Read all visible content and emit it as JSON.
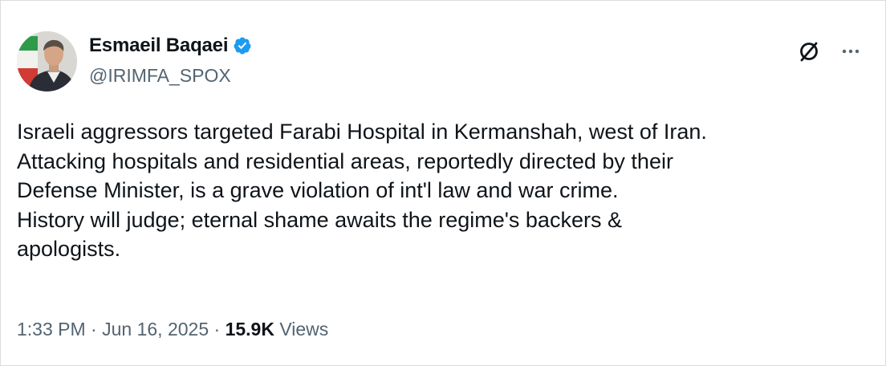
{
  "author": {
    "display_name": "Esmaeil Baqaei",
    "handle": "@IRIMFA_SPOX",
    "verified": true,
    "verified_color": "#1d9bf0"
  },
  "tweet": {
    "lines": [
      "Israeli aggressors targeted Farabi Hospital in Kermanshah, west of Iran.",
      "Attacking hospitals and residential areas, reportedly directed by their",
      "Defense Minister, is a grave violation of int'l law and war crime.",
      "History will judge; eternal shame awaits the regime's backers &",
      "apologists."
    ]
  },
  "meta": {
    "time": "1:33 PM",
    "separator": "·",
    "date": "Jun 16, 2025",
    "views_count": "15.9K",
    "views_label": "Views"
  },
  "icons": {
    "grok": "grok-slash-circle-icon",
    "more": "more-horizontal-icon"
  }
}
